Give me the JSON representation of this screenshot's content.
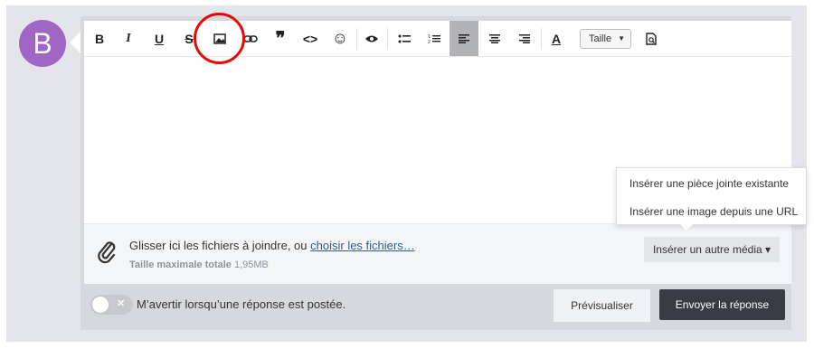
{
  "avatar": {
    "letter": "B",
    "color": "#a066c4"
  },
  "toolbar": {
    "buttons": [
      {
        "name": "bold-icon",
        "glyph": "B"
      },
      {
        "name": "italic-icon",
        "glyph": "I"
      },
      {
        "name": "underline-icon",
        "glyph": "U"
      },
      {
        "name": "strikethrough-icon",
        "glyph": "S"
      },
      {
        "name": "image-icon",
        "glyph": "🖼"
      },
      {
        "name": "link-icon",
        "glyph": "∞"
      },
      {
        "name": "quote-icon",
        "glyph": "❞"
      },
      {
        "name": "code-icon",
        "glyph": "<>"
      },
      {
        "name": "smiley-icon",
        "glyph": "☺"
      },
      {
        "name": "eye-icon",
        "glyph": "👁"
      },
      {
        "name": "bullet-list-icon",
        "glyph": "☰"
      },
      {
        "name": "numbered-list-icon",
        "glyph": "≡"
      },
      {
        "name": "align-left-icon",
        "glyph": "≣"
      },
      {
        "name": "align-center-icon",
        "glyph": "≡"
      },
      {
        "name": "align-right-icon",
        "glyph": "≡"
      },
      {
        "name": "text-color-icon",
        "glyph": "A"
      },
      {
        "name": "find-icon",
        "glyph": "🔍"
      }
    ],
    "size_label": "Taille"
  },
  "dropdown": {
    "items": [
      "Insérer une pièce jointe existante",
      "Insérer une image depuis une URL"
    ]
  },
  "attach": {
    "text": "Glisser ici les fichiers à joindre, ou ",
    "link": "choisir les fichiers…",
    "max_label": "Taille maximale totale",
    "max_value": "1,95MB",
    "media_button": "Insérer un autre média ▾"
  },
  "footer": {
    "notify_label": "M’avertir lorsqu’une réponse est postée.",
    "preview_label": "Prévisualiser",
    "send_label": "Envoyer la réponse"
  },
  "colors": {
    "annotation": "#e30a0a",
    "send_bg": "#3a3c45"
  }
}
